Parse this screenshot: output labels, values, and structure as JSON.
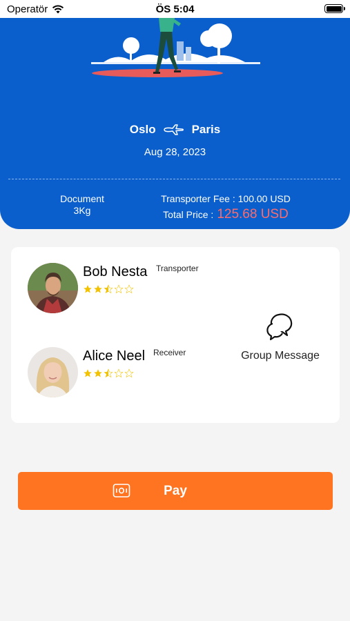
{
  "status_bar": {
    "carrier": "Operatör",
    "time": "ÖS 5:04"
  },
  "trip": {
    "origin": "Oslo",
    "destination": "Paris",
    "date": "Aug 28, 2023",
    "package_type": "Document",
    "package_weight": "3Kg",
    "transporter_fee": "Transporter Fee : 100.00 USD",
    "total_label": "Total Price :",
    "total_value": "125.68 USD"
  },
  "participants": [
    {
      "name": "Bob Nesta",
      "role": "Transporter",
      "rating": 2.5
    },
    {
      "name": "Alice Neel",
      "role": "Receiver",
      "rating": 2.5
    }
  ],
  "group_message": {
    "label": "Group Message"
  },
  "pay": {
    "label": "Pay"
  },
  "colors": {
    "header_blue": "#0a5fcc",
    "total_price_red": "#ff6b6b",
    "pay_orange": "#ff7421",
    "star_gold": "#f2c200"
  },
  "icons": [
    "wifi-icon",
    "battery-icon",
    "airplane-icon",
    "chat-bubbles-icon",
    "cash-icon"
  ]
}
